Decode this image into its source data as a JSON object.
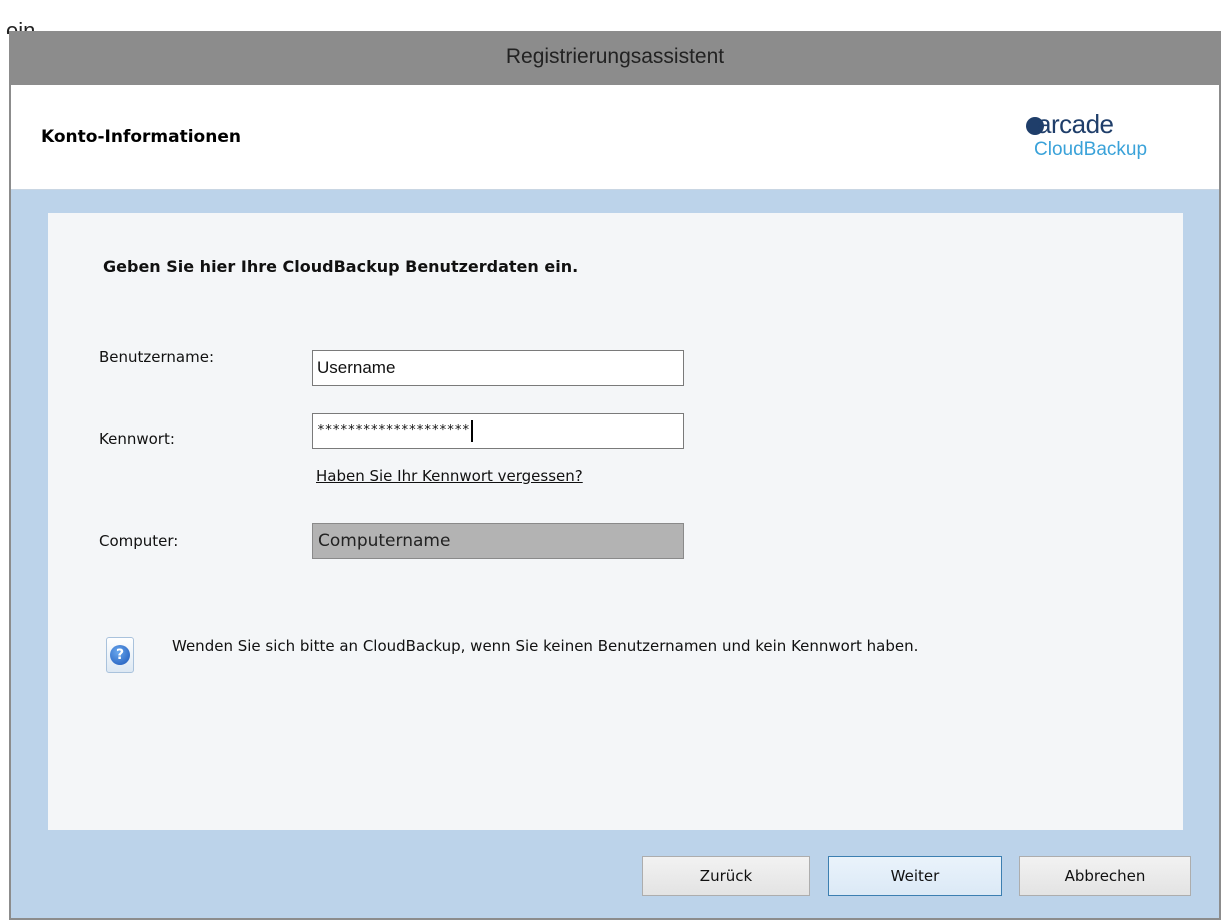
{
  "background_text": "ein",
  "window": {
    "title": "Registrierungsassistent"
  },
  "header": {
    "title": "Konto-Informationen",
    "logo": {
      "brand": "arcade",
      "product": "CloudBackup",
      "dot_color": "#1f3e6a",
      "product_color": "#3aa2d9"
    }
  },
  "form": {
    "heading": "Geben Sie hier Ihre CloudBackup Benutzerdaten ein.",
    "username_label": "Benutzername:",
    "username_value": "Username",
    "password_label": "Kennwort:",
    "password_value": "********************",
    "forgot_link": "Haben Sie Ihr Kennwort vergessen?",
    "computer_label": "Computer:",
    "computer_value": "Computername"
  },
  "info": {
    "icon": "help-question-icon",
    "text": "Wenden Sie sich bitte an CloudBackup, wenn Sie keinen Benutzernamen und kein Kennwort haben."
  },
  "buttons": {
    "back": "Zurück",
    "next": "Weiter",
    "cancel": "Abbrechen"
  },
  "colors": {
    "titlebar": "#8c8c8c",
    "body_background": "#bcd3ea",
    "panel_background": "#f4f6f8",
    "default_button_border": "#3c7fb1"
  }
}
